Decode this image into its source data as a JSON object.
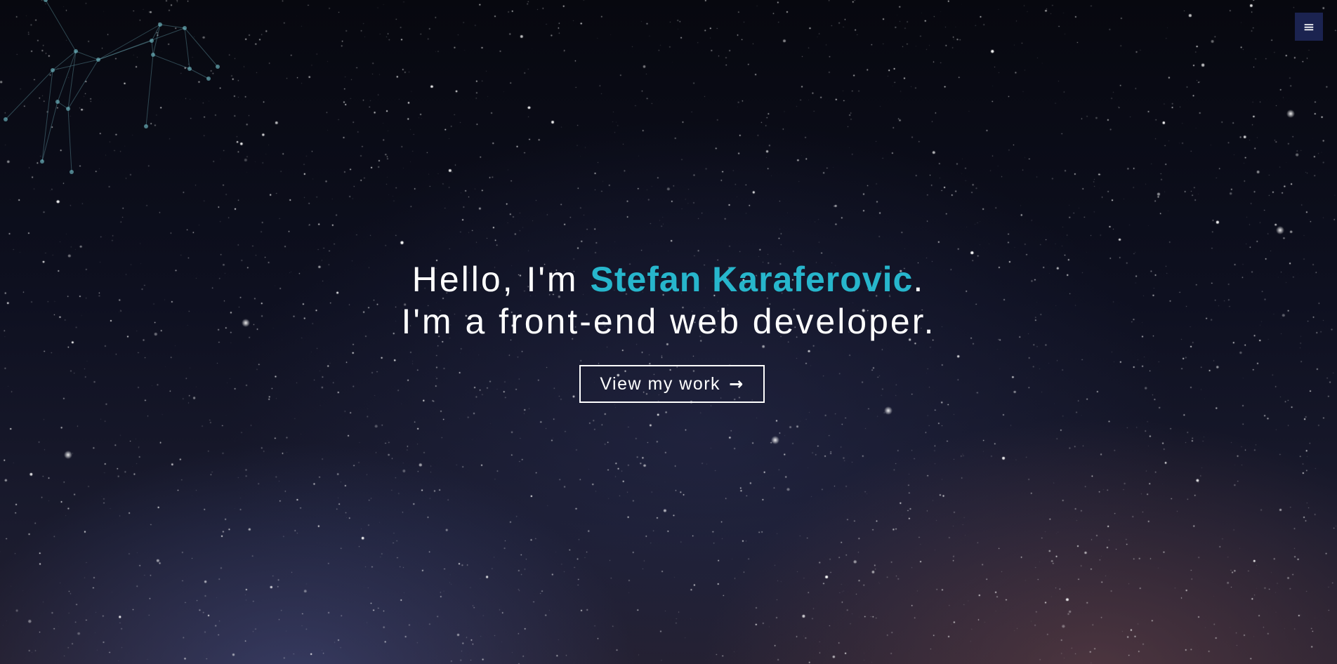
{
  "menu": {
    "icon": "hamburger-menu-icon",
    "glyph": "≡"
  },
  "hero": {
    "greeting": "Hello, I'm ",
    "name": "Stefan Karaferovic",
    "greeting_end": ".",
    "tagline": "I'm a front-end web developer.",
    "cta_label": "View my work",
    "cta_icon": "arrow-right-icon",
    "cta_glyph": "→"
  },
  "colors": {
    "accent": "#27b6cc",
    "menu_background": "#1b2350",
    "text": "#ffffff"
  }
}
